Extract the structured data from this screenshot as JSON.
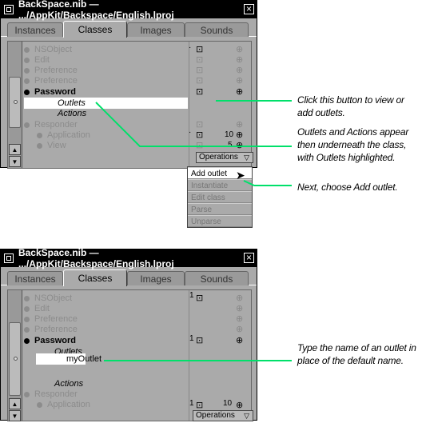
{
  "window1": {
    "title": "BackSpace.nib — .../AppKit/Backspace/English.lproj",
    "tabs": [
      "Instances",
      "Classes",
      "Images",
      "Sounds"
    ],
    "rows": [
      "NSObject",
      "Edit",
      "Preference",
      "Password",
      "Outlets",
      "Actions",
      "Responder",
      "Application",
      "View"
    ],
    "counts": [
      "1",
      "10",
      "5"
    ],
    "operations_label": "Operations",
    "menu_items": [
      "Add outlet",
      "Instantiate",
      "Edit class",
      "Parse",
      "Unparse"
    ]
  },
  "window2": {
    "title": "BackSpace.nib — .../AppKit/Backspace/English.lproj",
    "tabs": [
      "Instances",
      "Classes",
      "Images",
      "Sounds"
    ],
    "rows": [
      "NSObject",
      "Edit",
      "Preference",
      "Password",
      "Outlets",
      "Actions",
      "Responder",
      "Application"
    ],
    "edit_value": "myOutlet",
    "counts": [
      "1",
      "1",
      "1",
      "10"
    ],
    "operations_label": "Operations"
  },
  "callouts": {
    "c1": "Click this button to view or add outlets.",
    "c2": "Outlets and Actions appear then underneath the class, with Outlets highlighted.",
    "c3": "Next, choose Add outlet.",
    "c4": "Type the name of an outlet in place of the default name."
  },
  "colors": {
    "leader": "#00e06a",
    "window_bg": "#aaaaaa",
    "highlight": "#ffffff"
  },
  "icons": [
    "window-icon",
    "close-icon",
    "outlet-button-icon",
    "add-outlet-icon",
    "scroll-up-icon",
    "scroll-down-icon",
    "pulldown-arrow-icon",
    "cursor-arrow-icon"
  ]
}
